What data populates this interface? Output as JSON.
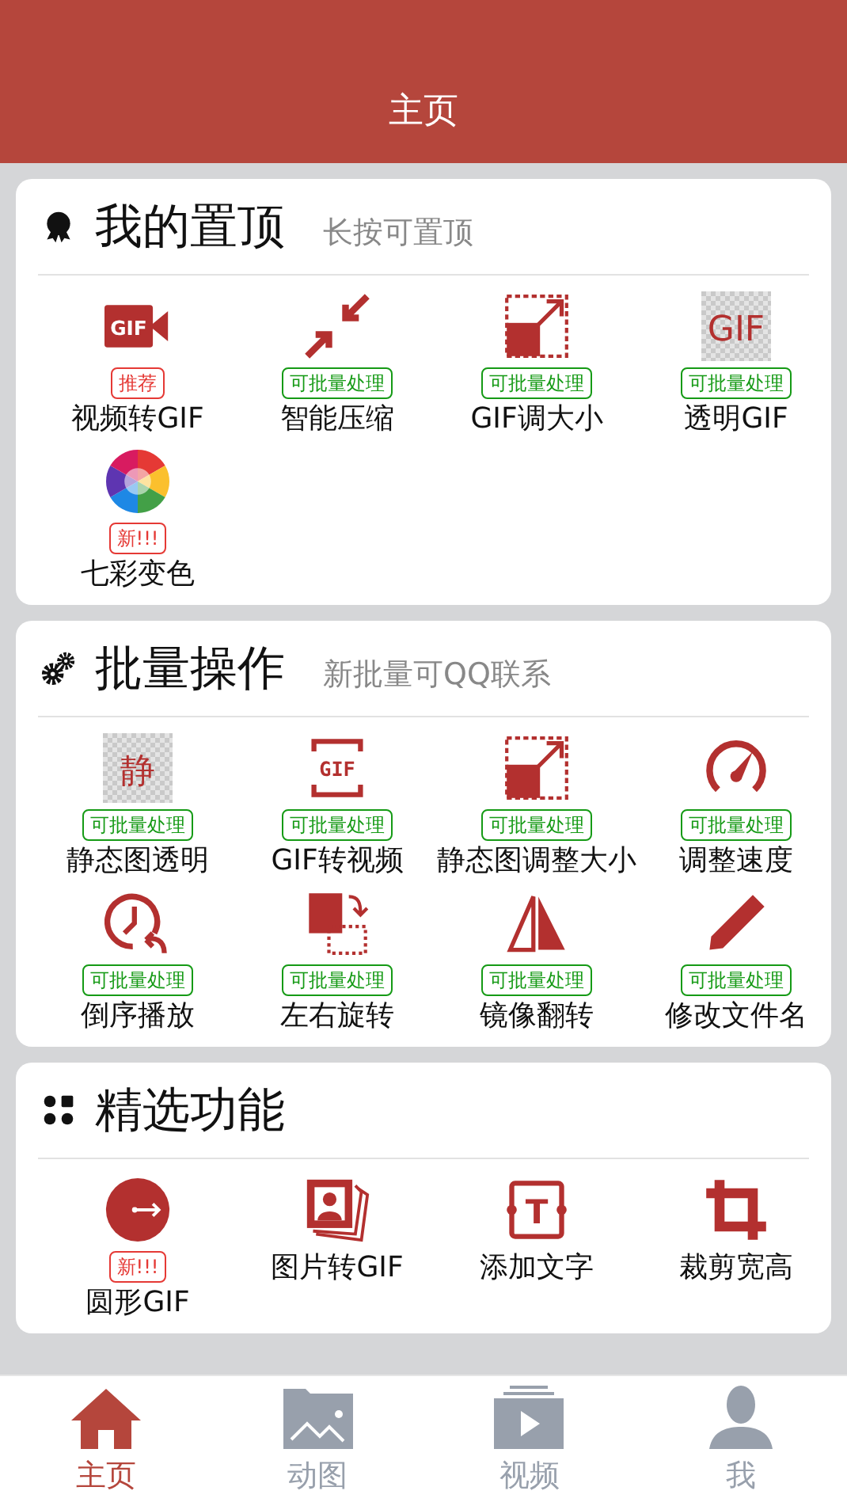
{
  "header": {
    "title": "主页"
  },
  "sections": [
    {
      "title": "我的置顶",
      "subtitle": "长按可置顶",
      "items": [
        {
          "label": "视频转GIF",
          "icon_text": "GIF",
          "badge": {
            "text": "推荐",
            "kind": "hot"
          }
        },
        {
          "label": "智能压缩",
          "badge": {
            "text": "可批量处理",
            "kind": "batch"
          }
        },
        {
          "label": "GIF调大小",
          "badge": {
            "text": "可批量处理",
            "kind": "batch"
          }
        },
        {
          "label": "透明GIF",
          "icon_text": "GIF",
          "badge": {
            "text": "可批量处理",
            "kind": "batch"
          }
        },
        {
          "label": "七彩变色",
          "badge": {
            "text": "新!!!",
            "kind": "hot"
          }
        }
      ]
    },
    {
      "title": "批量操作",
      "subtitle": "新批量可QQ联系",
      "items": [
        {
          "label": "静态图透明",
          "icon_text": "静",
          "badge": {
            "text": "可批量处理",
            "kind": "batch"
          }
        },
        {
          "label": "GIF转视频",
          "icon_text": "GIF",
          "badge": {
            "text": "可批量处理",
            "kind": "batch"
          }
        },
        {
          "label": "静态图调整大小",
          "badge": {
            "text": "可批量处理",
            "kind": "batch"
          }
        },
        {
          "label": "调整速度",
          "badge": {
            "text": "可批量处理",
            "kind": "batch"
          }
        },
        {
          "label": "倒序播放",
          "badge": {
            "text": "可批量处理",
            "kind": "batch"
          }
        },
        {
          "label": "左右旋转",
          "badge": {
            "text": "可批量处理",
            "kind": "batch"
          }
        },
        {
          "label": "镜像翻转",
          "badge": {
            "text": "可批量处理",
            "kind": "batch"
          }
        },
        {
          "label": "修改文件名",
          "badge": {
            "text": "可批量处理",
            "kind": "batch"
          }
        }
      ]
    },
    {
      "title": "精选功能",
      "items": [
        {
          "label": "圆形GIF",
          "badge": {
            "text": "新!!!",
            "kind": "hot"
          }
        },
        {
          "label": "图片转GIF"
        },
        {
          "label": "添加文字",
          "icon_text": "T"
        },
        {
          "label": "裁剪宽高"
        }
      ]
    }
  ],
  "tabs": [
    {
      "label": "主页",
      "selected": true
    },
    {
      "label": "动图",
      "selected": false
    },
    {
      "label": "视频",
      "selected": false
    },
    {
      "label": "我",
      "selected": false
    }
  ]
}
